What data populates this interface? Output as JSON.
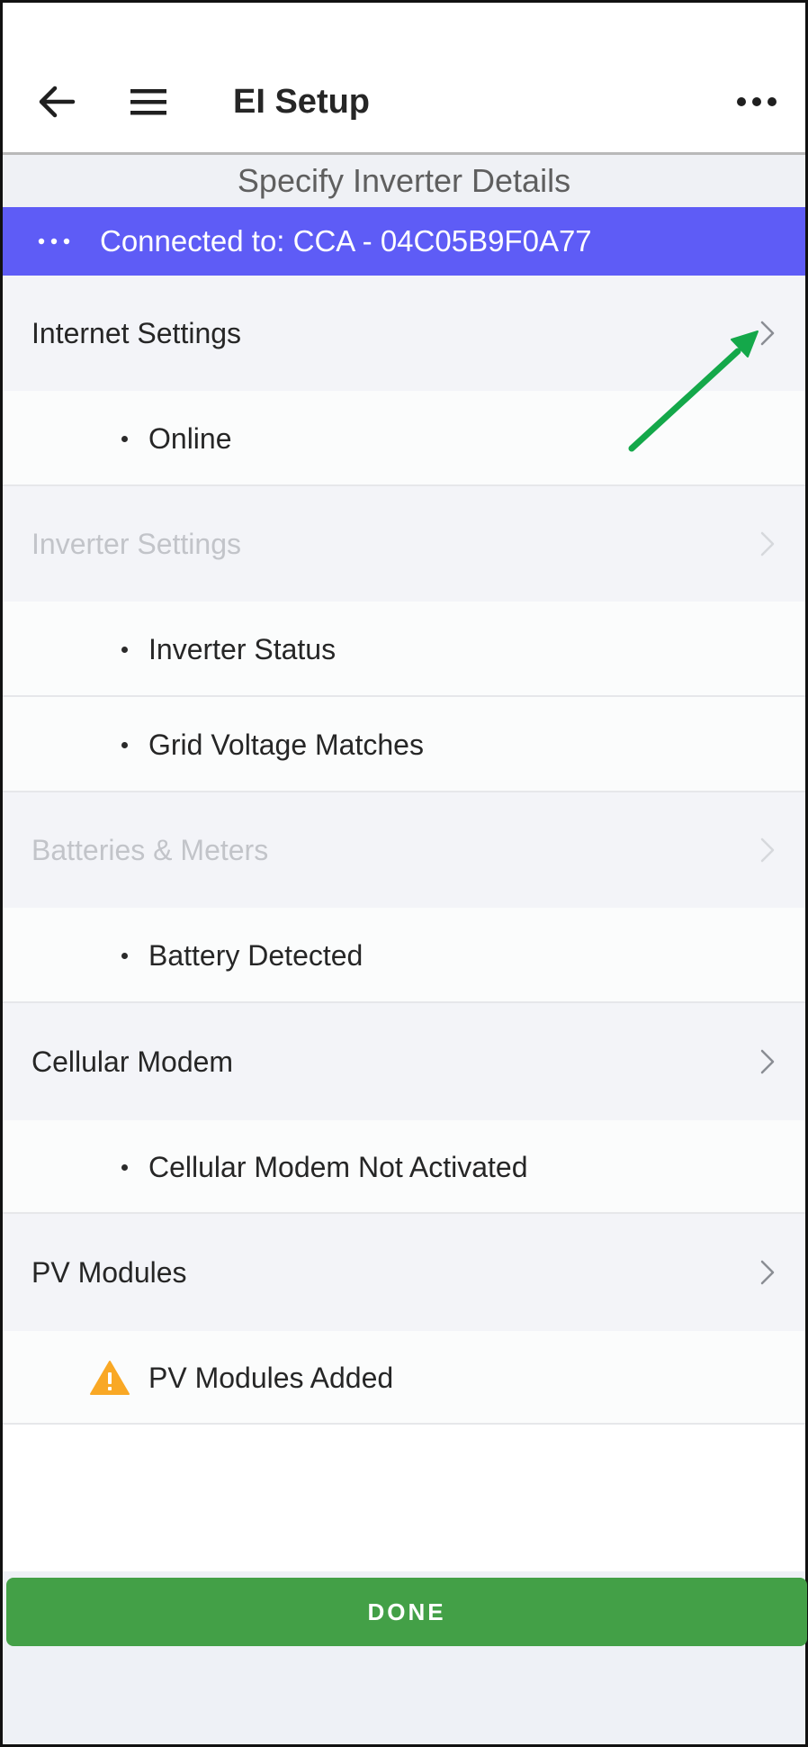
{
  "header": {
    "title": "EI Setup",
    "back_icon": "back-arrow-icon",
    "menu_icon": "hamburger-menu-icon",
    "more_icon": "more-horizontal-icon"
  },
  "subheader": {
    "title": "Specify Inverter Details"
  },
  "connection": {
    "text": "Connected to: CCA - 04C05B9F0A77",
    "color": "#5e5cf6"
  },
  "sections": [
    {
      "label": "Internet Settings",
      "enabled": true,
      "items": [
        {
          "text": "Online",
          "icon": "bullet"
        }
      ]
    },
    {
      "label": "Inverter Settings",
      "enabled": false,
      "items": [
        {
          "text": "Inverter Status",
          "icon": "bullet"
        },
        {
          "text": "Grid Voltage Matches",
          "icon": "bullet"
        }
      ]
    },
    {
      "label": "Batteries & Meters",
      "enabled": false,
      "items": [
        {
          "text": "Battery Detected",
          "icon": "bullet"
        }
      ]
    },
    {
      "label": "Cellular Modem",
      "enabled": true,
      "items": [
        {
          "text": "Cellular Modem Not Activated",
          "icon": "bullet"
        }
      ]
    },
    {
      "label": "PV Modules",
      "enabled": true,
      "items": [
        {
          "text": "PV Modules Added",
          "icon": "warning-icon"
        }
      ]
    }
  ],
  "annotation": {
    "color": "#14a84a"
  },
  "done": {
    "label": "DONE",
    "color": "#43a047"
  }
}
